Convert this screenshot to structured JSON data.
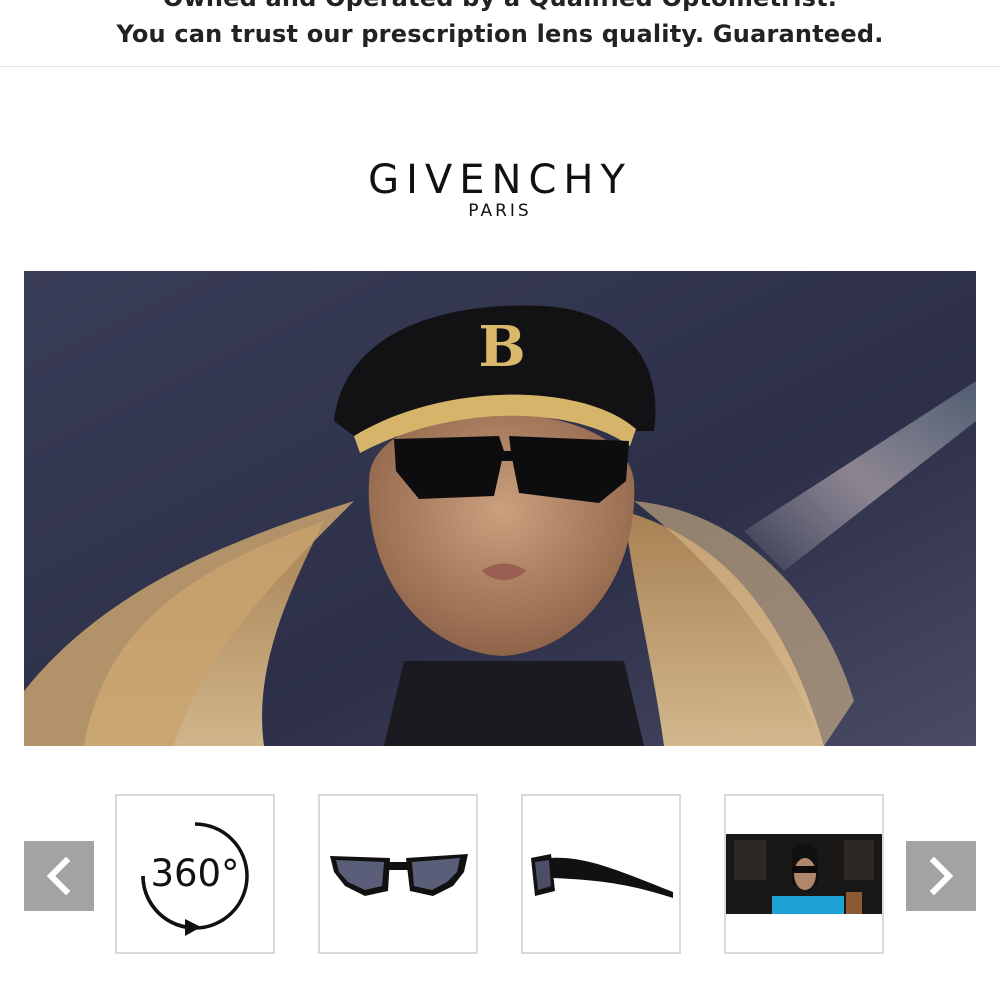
{
  "banner": {
    "line1": "Owned and Operated by a Qualified Optometrist.",
    "line2": "You can trust our prescription lens quality. Guaranteed."
  },
  "brand": {
    "name": "GIVENCHY",
    "subtitle": "PARIS"
  },
  "hero": {
    "cap_monogram": "B"
  },
  "gallery": {
    "prev_icon": "chevron-left-icon",
    "next_icon": "chevron-right-icon",
    "thumbnails": [
      {
        "kind": "360-view",
        "label": "360°"
      },
      {
        "kind": "front-view"
      },
      {
        "kind": "side-view"
      },
      {
        "kind": "model-photo"
      }
    ]
  },
  "colors": {
    "arrow_bg": "#a3a3a3",
    "thumb_border": "#d9d9d9",
    "hero_bg": "#2e3149"
  }
}
